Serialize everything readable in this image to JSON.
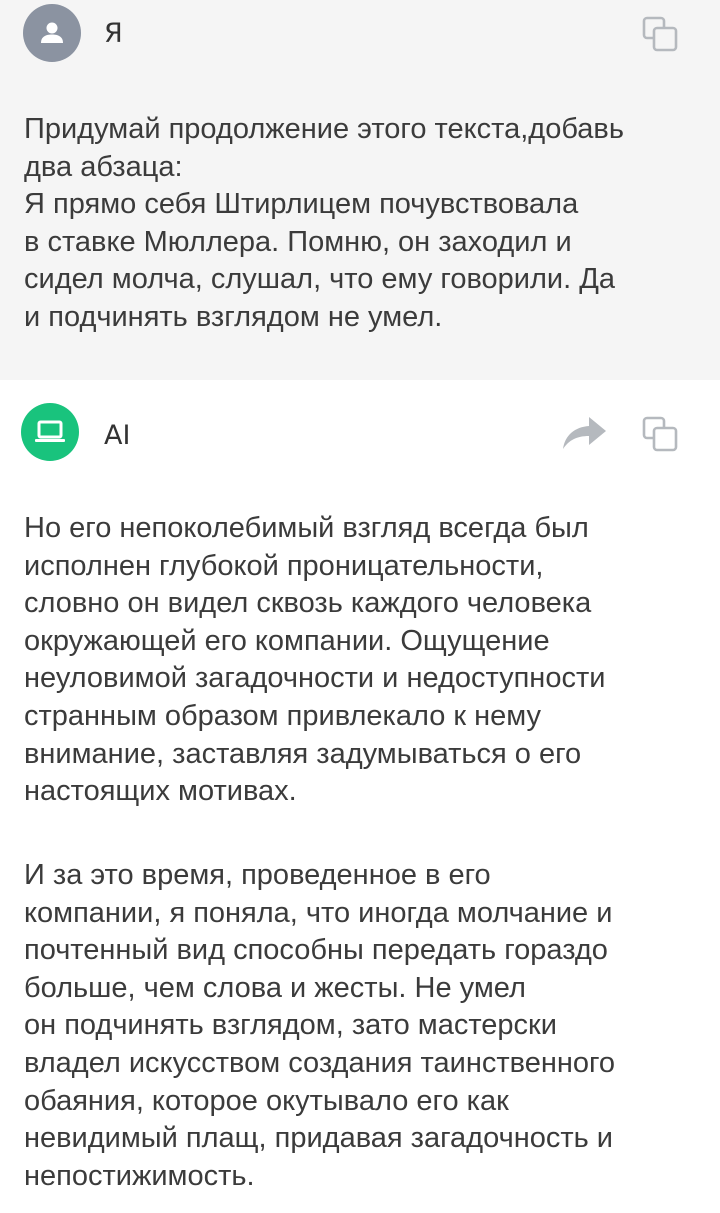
{
  "user_message": {
    "sender": "Я",
    "text": "Придумай продолжение этого текста,добавь\nдва абзаца:\nЯ прямо себя Штирлицем почувствовала\nв ставке Мюллера. Помню, он заходил и\nсидел молча, слушал, что ему говорили. Да\nи подчинять взглядом не умел."
  },
  "ai_message": {
    "sender": "AI",
    "paragraphs": [
      "Но его непоколебимый взгляд всегда был\nисполнен глубокой проницательности,\nсловно он видел сквозь каждого человека\nокружающей его компании. Ощущение\nнеуловимой загадочности и недоступности\nстранным образом привлекало к нему\nвнимание, заставляя задумываться о его\nнастоящих мотивах.",
      "И за это время, проведенное в его\nкомпании, я поняла, что иногда молчание и\nпочтенный вид способны передать гораздо\nбольше, чем слова и жесты. Не умел\nон подчинять взглядом, зато мастерски\nвладел искусством создания таинственного\nобаяния, которое окутывало его как\nневидимый плащ, придавая загадочность и\nнепостижимость."
    ]
  },
  "icons": {
    "user_avatar": "person-icon",
    "ai_avatar": "laptop-icon",
    "copy": "copy-icon",
    "share": "share-arrow-icon"
  },
  "colors": {
    "user_bg": "#f5f5f5",
    "ai_avatar": "#19c37d",
    "user_avatar": "#8b93a1",
    "icon_gray": "#b5b9be"
  }
}
